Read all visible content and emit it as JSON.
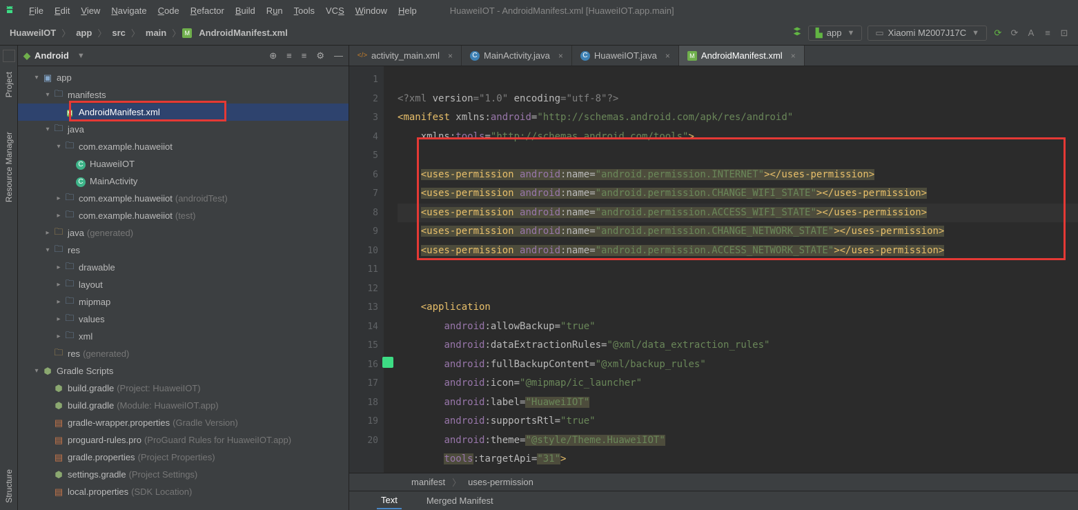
{
  "window_title": "HuaweiIOT - AndroidManifest.xml [HuaweiIOT.app.main]",
  "menu": {
    "file": "File",
    "edit": "Edit",
    "view": "View",
    "navigate": "Navigate",
    "code": "Code",
    "refactor": "Refactor",
    "build": "Build",
    "run": "Run",
    "tools": "Tools",
    "vcs": "VCS",
    "window": "Window",
    "help": "Help"
  },
  "breadcrumb": {
    "proj": "HuaweiIOT",
    "app": "app",
    "src": "src",
    "main": "main",
    "file": "AndroidManifest.xml"
  },
  "run_config": {
    "name": "app"
  },
  "device": {
    "name": "Xiaomi M2007J17C"
  },
  "left_strip": {
    "project": "Project",
    "resmgr": "Resource Manager",
    "structure": "Structure"
  },
  "project_header": {
    "title": "Android"
  },
  "tree": {
    "app": "app",
    "manifests": "manifests",
    "manifest_file": "AndroidManifest.xml",
    "java": "java",
    "pkg": "com.example.huaweiiot",
    "cls1": "HuaweiIOT",
    "cls2": "MainActivity",
    "pkg_at": "com.example.huaweiiot",
    "pkg_at_sfx": "(androidTest)",
    "pkg_t": "com.example.huaweiiot",
    "pkg_t_sfx": "(test)",
    "java_gen": "java",
    "java_gen_sfx": "(generated)",
    "res": "res",
    "drawable": "drawable",
    "layout": "layout",
    "mipmap": "mipmap",
    "values": "values",
    "xml": "xml",
    "res_gen": "res",
    "res_gen_sfx": "(generated)",
    "gradle": "Gradle Scripts",
    "bg1": "build.gradle",
    "bg1s": "(Project: HuaweiIOT)",
    "bg2": "build.gradle",
    "bg2s": "(Module: HuaweiIOT.app)",
    "gw": "gradle-wrapper.properties",
    "gws": "(Gradle Version)",
    "pg": "proguard-rules.pro",
    "pgs": "(ProGuard Rules for HuaweiIOT.app)",
    "gp": "gradle.properties",
    "gps": "(Project Properties)",
    "sg": "settings.gradle",
    "sgs": "(Project Settings)",
    "lp": "local.properties",
    "lps": "(SDK Location)"
  },
  "editor_tabs": {
    "t1": "activity_main.xml",
    "t2": "MainActivity.java",
    "t3": "HuaweiIOT.java",
    "t4": "AndroidManifest.xml"
  },
  "code": {
    "l1_a": "<?xml ",
    "l1_b": "version",
    "l1_c": "=\"1.0\" ",
    "l1_d": "encoding",
    "l1_e": "=\"utf-8\"?>",
    "l2_a": "<",
    "l2_b": "manifest ",
    "l2_c": "xmlns:",
    "l2_d": "android",
    "l2_e": "=",
    "l2_f": "\"http://schemas.android.com/apk/res/android\"",
    "l3_a": "xmlns:",
    "l3_b": "tools",
    "l3_c": "=",
    "l3_d": "\"http://schemas.android.com/tools\"",
    "l3_e": ">",
    "perm_open": "<uses-permission ",
    "perm_attr": "android",
    "perm_colon": ":",
    "perm_name": "name",
    "perm_eq": "=",
    "perm_v1": "\"android.permission.INTERNET\"",
    "perm_v2": "\"android.permission.CHANGE_WIFI_STATE\"",
    "perm_v3": "\"android.permission.ACCESS_WIFI_STATE\"",
    "perm_v4": "\"android.permission.CHANGE_NETWORK_STATE\"",
    "perm_v5": "\"android.permission.ACCESS_NETWORK_STATE\"",
    "perm_close": "></uses-permission>",
    "app_open": "<application",
    "a1": "android",
    "p1": ":allowBackup=",
    "v1": "\"true\"",
    "p2": ":dataExtractionRules=",
    "v2": "\"@xml/data_extraction_rules\"",
    "p3": ":fullBackupContent=",
    "v3": "\"@xml/backup_rules\"",
    "p4": ":icon=",
    "v4": "\"@mipmap/ic_launcher\"",
    "p5": ":label=",
    "v5": "\"HuaweiIOT\"",
    "p6": ":supportsRtl=",
    "v6": "\"true\"",
    "p7": ":theme=",
    "v7": "\"@style/Theme.HuaweiIOT\"",
    "tools": "tools",
    "p8": ":targetApi=",
    "v8": "\"31\"",
    "gt": ">"
  },
  "gutter_lines": [
    "1",
    "2",
    "3",
    "4",
    "5",
    "6",
    "7",
    "8",
    "9",
    "10",
    "11",
    "12",
    "13",
    "14",
    "15",
    "16",
    "17",
    "18",
    "19",
    "20"
  ],
  "crumb_bar": {
    "a": "manifest",
    "b": "uses-permission"
  },
  "lower_tabs": {
    "text": "Text",
    "merged": "Merged Manifest"
  }
}
